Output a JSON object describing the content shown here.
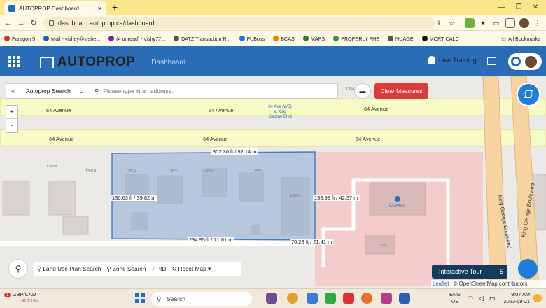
{
  "browser": {
    "tab_title": "AUTOPROP Dashboard",
    "new_tab": "+",
    "url": "dashboard.autoprop.ca/dashboard",
    "bookmarks": [
      {
        "label": "Paragon 5",
        "color": "#d32f2f"
      },
      {
        "label": "Mail - vishey@vishe...",
        "color": "#1565c0"
      },
      {
        "label": "(4 unread) - vishy77...",
        "color": "#7b1fa2"
      },
      {
        "label": "DATZ Transaction R...",
        "color": "#555555"
      },
      {
        "label": "FUBoss",
        "color": "#1976d2"
      },
      {
        "label": "BCAS",
        "color": "#f57c00"
      },
      {
        "label": "MAPS",
        "color": "#2e7d32"
      },
      {
        "label": "PROPERLY FHE",
        "color": "#388e3c"
      },
      {
        "label": "NUAGE",
        "color": "#555555"
      },
      {
        "label": "MORT CALC",
        "color": "#111111"
      }
    ],
    "all_bookmarks": "All Bookmarks"
  },
  "app": {
    "logo": "AUTOPROP",
    "section": "Dashboard",
    "live_training": "Live Training"
  },
  "search": {
    "collapse": "«",
    "mode": "Autoprop Search",
    "placeholder": "Please type in an address.",
    "clear_measures": "Clear Measures"
  },
  "zoom": {
    "in": "+",
    "out": "-"
  },
  "map": {
    "roads": {
      "top": "64 Avenue",
      "bottom": "64 Avenue",
      "king_george": "King George Boulevard",
      "bus_stop": "64 Ave (WB) at King George Blvd"
    },
    "lots": [
      "13498",
      "13514",
      "13524",
      "13532",
      "13542",
      "13550",
      "13556",
      "13562",
      "1354"
    ],
    "poi": "Chevron",
    "measures": [
      "302.30 ft / 92.14 m",
      "130.63 ft / 39.82 m",
      "138.99 ft / 42.37 m",
      "234.95 ft / 71.61 m",
      "70.23 ft / 21.41 m"
    ],
    "attribution": {
      "leaflet": "Leaflet",
      "osm": "© OpenStreetMap contributors"
    }
  },
  "bottom_tools": {
    "land_use": "Land Use Plan Search",
    "zone": "Zone Search",
    "pid": "PID",
    "reset": "Reset Map"
  },
  "tour": {
    "label": "Interactive Tour",
    "count": "5"
  },
  "taskbar": {
    "weather_badge": "1",
    "ticker": "GBP/CAD",
    "change": "-0.21%",
    "search": "Search",
    "lang1": "ENG",
    "lang2": "US",
    "time": "9:07 AM",
    "date": "2023-09-21"
  }
}
